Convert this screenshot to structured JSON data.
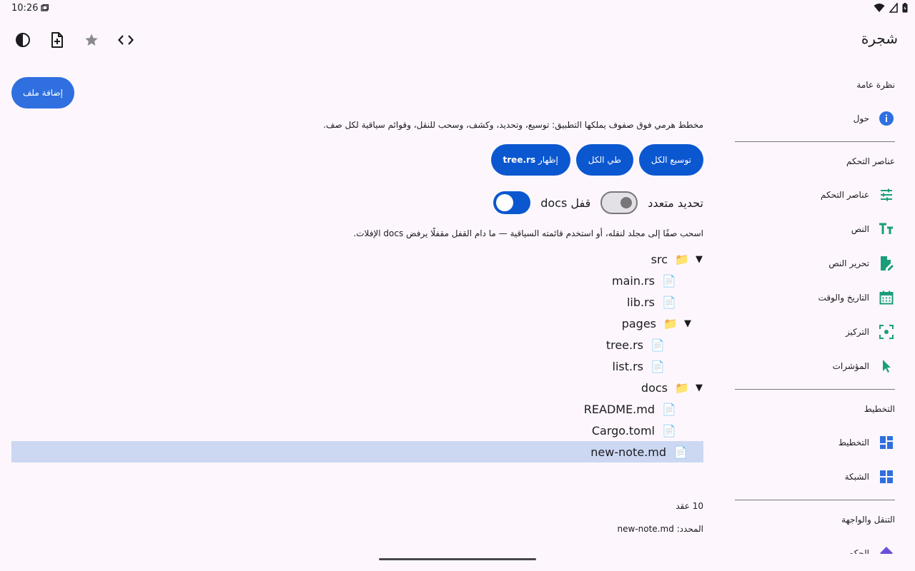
{
  "status": {
    "time": "10:26"
  },
  "app": {
    "title": "شجرة",
    "actions": [
      "theme-icon",
      "new-file-icon",
      "star-icon",
      "code-icon"
    ]
  },
  "main": {
    "add_file_label": "إضافة ملف",
    "description": "مخطط هرمي فوق صفوف يملكها التطبيق: توسيع، وتحديد، وكشف، وسحب للنقل، وقوائم سياقية لكل صف.",
    "buttons": {
      "expand_all": "توسيع الكل",
      "collapse_all": "طي الكل",
      "reveal_prefix": "إظهار",
      "reveal_file": "tree.rs"
    },
    "multi_select_label": "تحديد متعدد",
    "multi_select_on": false,
    "lock_docs_label": "قفل docs",
    "lock_docs_on": true,
    "hint": "اسحب صفًا إلى مجلد لنقله، أو استخدم قائمته السياقية — ما دام القفل مقفلًا يرفض docs الإفلات.",
    "tree": [
      {
        "name": "src",
        "type": "folder",
        "depth": 0,
        "expanded": true
      },
      {
        "name": "main.rs",
        "type": "file",
        "depth": 1
      },
      {
        "name": "lib.rs",
        "type": "file",
        "depth": 1
      },
      {
        "name": "pages",
        "type": "folder",
        "depth": 1,
        "expanded": true
      },
      {
        "name": "tree.rs",
        "type": "file",
        "depth": 2
      },
      {
        "name": "list.rs",
        "type": "file",
        "depth": 2
      },
      {
        "name": "docs",
        "type": "folder",
        "depth": 0,
        "expanded": true
      },
      {
        "name": "README.md",
        "type": "file",
        "depth": 1
      },
      {
        "name": "Cargo.toml",
        "type": "file",
        "depth": 1
      },
      {
        "name": "new-note.md",
        "type": "file",
        "depth": 0,
        "selected": true
      }
    ],
    "node_count": "10 عقد",
    "selected_label": "المحدد:",
    "selected_value": "new-note.md"
  },
  "sidebar": {
    "sections": [
      {
        "title": "نظرة عامة",
        "items": [
          {
            "label": "حول",
            "icon": "info-icon",
            "color": "#2f6fdf"
          }
        ]
      },
      {
        "title": "عناصر التحكم",
        "items": [
          {
            "label": "عناصر التحكم",
            "icon": "sliders-icon",
            "color": "#1a9e7a"
          },
          {
            "label": "النص",
            "icon": "text-icon",
            "color": "#1a9e7a"
          },
          {
            "label": "تحرير النص",
            "icon": "edit-doc-icon",
            "color": "#1a9e7a"
          },
          {
            "label": "التاريخ والوقت",
            "icon": "calendar-icon",
            "color": "#1a9e7a"
          },
          {
            "label": "التركيز",
            "icon": "focus-icon",
            "color": "#1a9e7a"
          },
          {
            "label": "المؤشرات",
            "icon": "pointer-icon",
            "color": "#1a9e7a"
          }
        ]
      },
      {
        "title": "التخطيط",
        "items": [
          {
            "label": "التخطيط",
            "icon": "dashboard-icon",
            "color": "#2f6fdf"
          },
          {
            "label": "الشبكة",
            "icon": "grid-icon",
            "color": "#2f6fdf"
          }
        ]
      },
      {
        "title": "التنقل والواجهة",
        "items": [
          {
            "label": "الحكم",
            "icon": "diamond-icon",
            "color": "#6b4fd8"
          }
        ]
      }
    ]
  }
}
